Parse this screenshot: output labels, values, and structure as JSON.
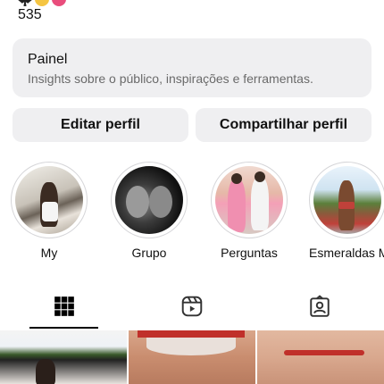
{
  "profile": {
    "emoji_icons": [
      "spade-icon",
      "hand-icon",
      "heart-icon"
    ],
    "count": "535"
  },
  "panel": {
    "title": "Painel",
    "subtitle": "Insights sobre o público, inspirações e ferramentas."
  },
  "buttons": {
    "edit": "Editar perfil",
    "share": "Compartilhar perfil"
  },
  "highlights": [
    {
      "label": "My"
    },
    {
      "label": "Grupo"
    },
    {
      "label": "Perguntas"
    },
    {
      "label": "Esmeraldas M"
    }
  ],
  "tabs": [
    {
      "icon": "grid-icon",
      "active": true
    },
    {
      "icon": "reels-icon",
      "active": false
    },
    {
      "icon": "tagged-icon",
      "active": false
    }
  ],
  "colors": {
    "button_bg": "#efeff1",
    "text": "#111111",
    "subtext": "#6a6a6a"
  }
}
